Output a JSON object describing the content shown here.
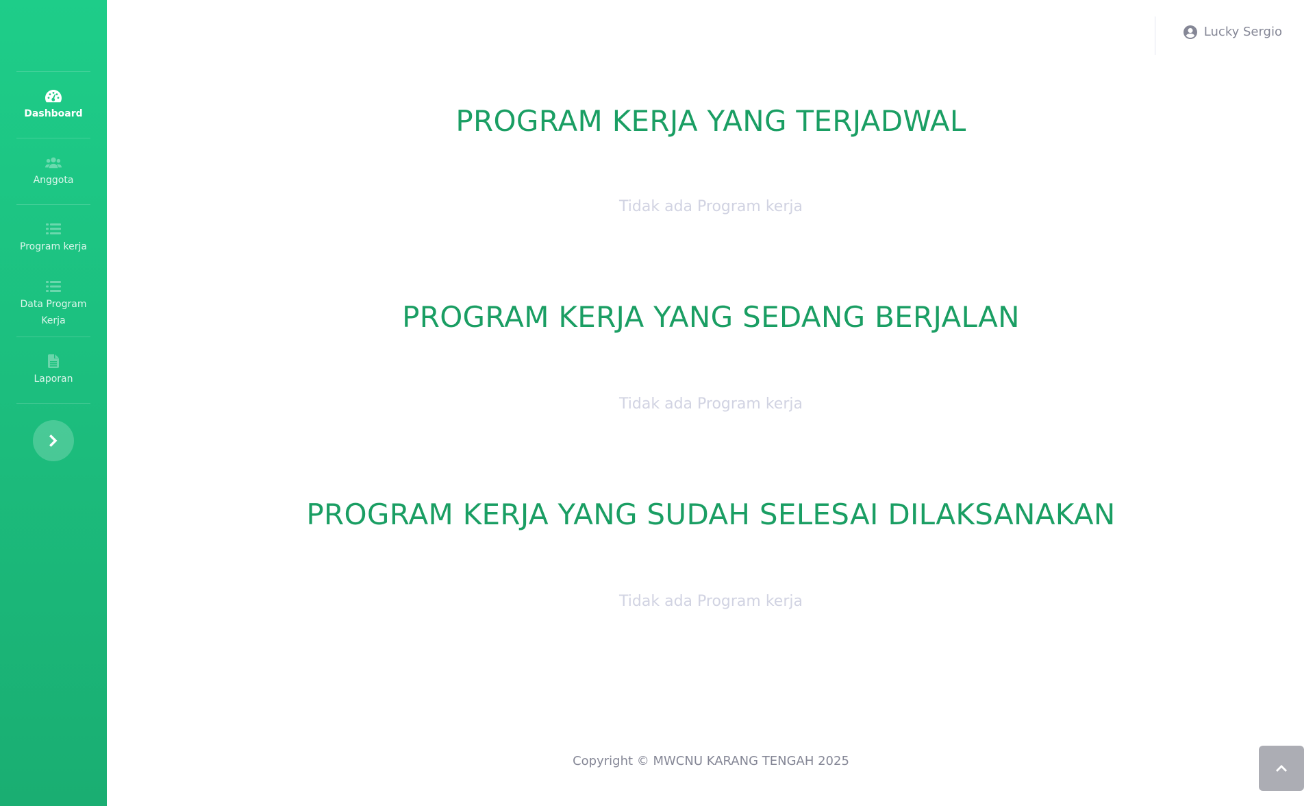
{
  "sidebar": {
    "items": [
      {
        "label": "Dashboard",
        "icon": "tachometer-icon",
        "active": true
      },
      {
        "label": "Anggota",
        "icon": "users-icon"
      },
      {
        "label": "Program kerja",
        "icon": "list-icon"
      },
      {
        "label": "Data Program Kerja",
        "icon": "list-icon"
      },
      {
        "label": "Laporan",
        "icon": "file-icon"
      }
    ],
    "toggle_icon": "chevron-right-icon"
  },
  "topbar": {
    "user_name": "Lucky Sergio",
    "user_icon": "user-circle-icon"
  },
  "sections": [
    {
      "title": "PROGRAM KERJA YANG TERJADWAL",
      "empty_text": "Tidak ada Program kerja"
    },
    {
      "title": "PROGRAM KERJA YANG SEDANG BERJALAN",
      "empty_text": "Tidak ada Program kerja"
    },
    {
      "title": "PROGRAM KERJA YANG SUDAH SELESAI DILAKSANAKAN",
      "empty_text": "Tidak ada Program kerja"
    }
  ],
  "footer": {
    "copyright": "Copyright © MWCNU KARANG TENGAH 2025"
  },
  "scroll_top_icon": "angle-up-icon",
  "colors": {
    "sidebar_top": "#1ecd89",
    "sidebar_bottom": "#1aae72",
    "title": "#1a9e63",
    "muted": "#d1d3e2",
    "text_gray": "#858796"
  }
}
